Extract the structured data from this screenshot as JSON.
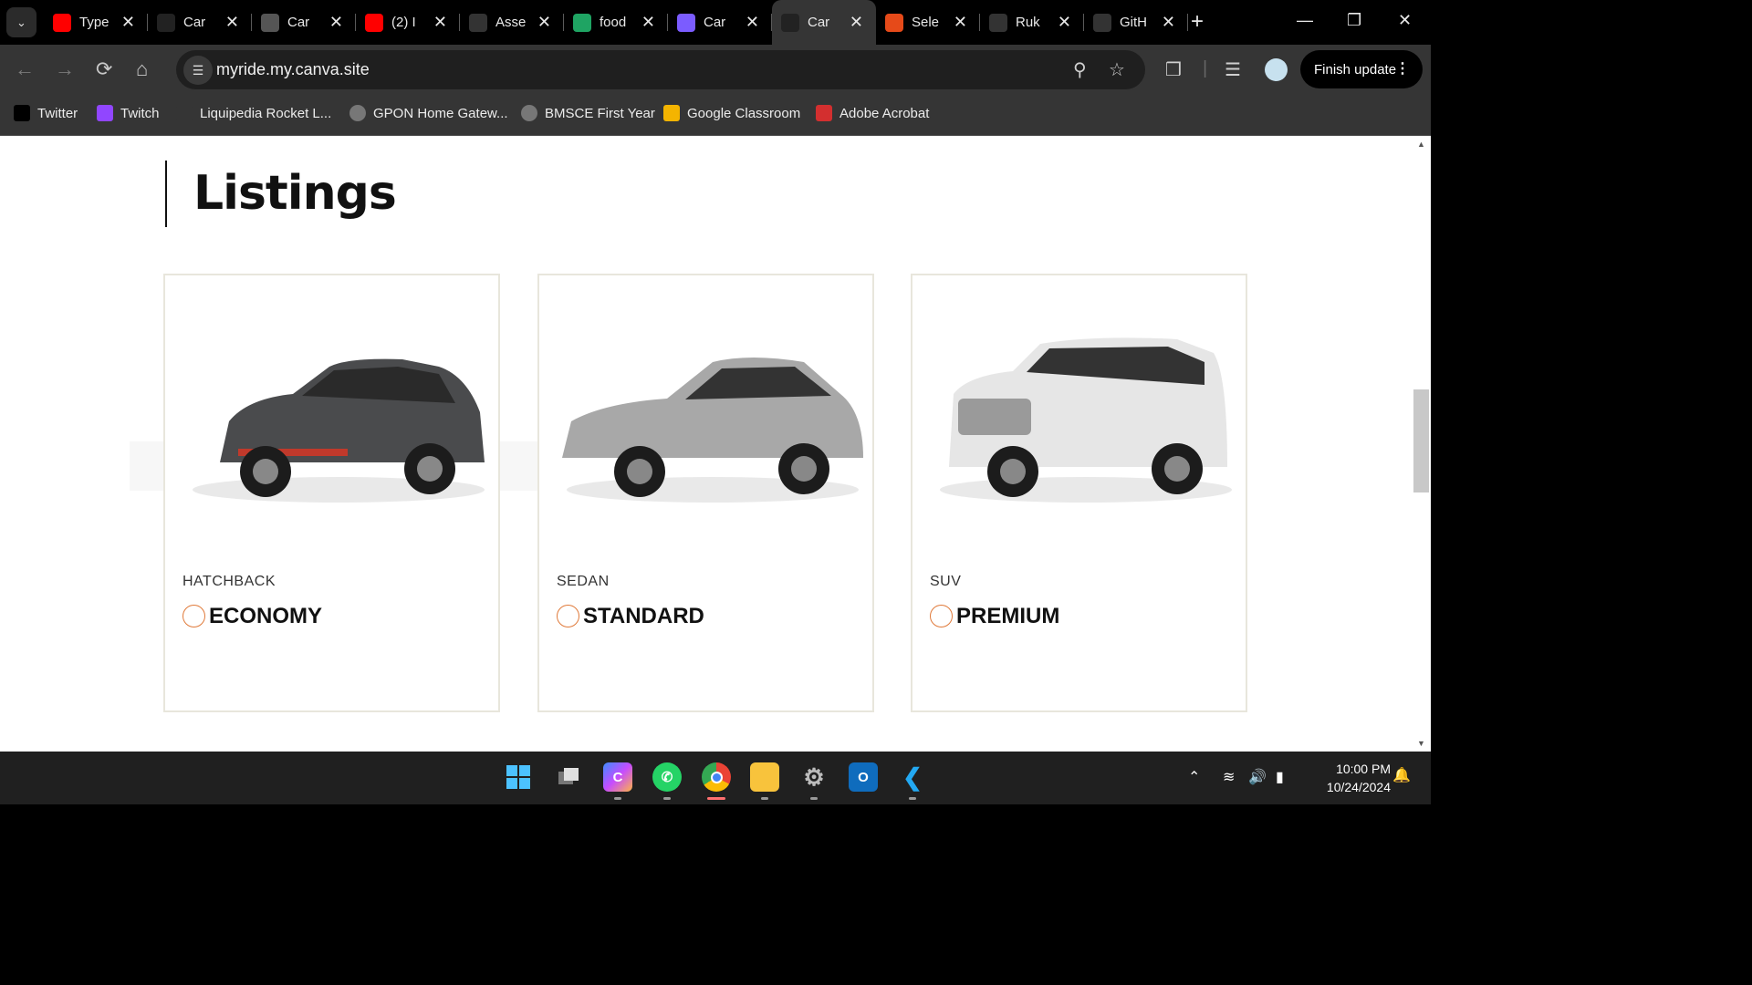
{
  "tabs": [
    {
      "title": "Type",
      "favicon": "youtube-icon",
      "color": "#ff0000"
    },
    {
      "title": "Car",
      "favicon": "canva-dark-icon",
      "color": "#222222"
    },
    {
      "title": "Car",
      "favicon": "globe-icon",
      "color": "#555555"
    },
    {
      "title": "(2) I",
      "favicon": "youtube-icon",
      "color": "#ff0000"
    },
    {
      "title": "Asse",
      "favicon": "assess-icon",
      "color": "#333333"
    },
    {
      "title": "food",
      "favicon": "google-drive-icon",
      "color": "#1fa463"
    },
    {
      "title": "Car",
      "favicon": "canva-calendar-icon",
      "color": "#7b5cff"
    },
    {
      "title": "Car",
      "favicon": "canva-dark-icon",
      "color": "#222222",
      "active": true
    },
    {
      "title": "Sele",
      "favicon": "selenium-icon",
      "color": "#e64a19"
    },
    {
      "title": "Ruk",
      "favicon": "github-icon",
      "color": "#333333"
    },
    {
      "title": "GitH",
      "favicon": "openai-icon",
      "color": "#333333"
    }
  ],
  "omnibox": {
    "url": "myride.my.canva.site"
  },
  "profile": {
    "finish_update_label": "Finish update"
  },
  "bookmarks": [
    {
      "label": "Twitter",
      "icon": "x-icon"
    },
    {
      "label": "Twitch",
      "icon": "twitch-icon"
    },
    {
      "label": "Liquipedia Rocket L...",
      "icon": "liquipedia-icon"
    },
    {
      "label": "GPON Home Gatew...",
      "icon": "globe-icon"
    },
    {
      "label": "BMSCE First Year",
      "icon": "globe-icon"
    },
    {
      "label": "Google Classroom",
      "icon": "google-classroom-icon"
    },
    {
      "label": "Adobe Acrobat",
      "icon": "adobe-acrobat-icon"
    }
  ],
  "page": {
    "heading": "Listings",
    "cards": [
      {
        "category": "HATCHBACK",
        "tier": "ECONOMY",
        "car": "hatchback-car-image",
        "body_color": "#4a4b4d"
      },
      {
        "category": "SEDAN",
        "tier": "STANDARD",
        "car": "sedan-car-image",
        "body_color": "#a8a8a8"
      },
      {
        "category": "SUV",
        "tier": "PREMIUM",
        "car": "suv-car-image",
        "body_color": "#e6e6e6"
      }
    ]
  },
  "taskbar": {
    "time": "10:00 PM",
    "date": "10/24/2024"
  }
}
